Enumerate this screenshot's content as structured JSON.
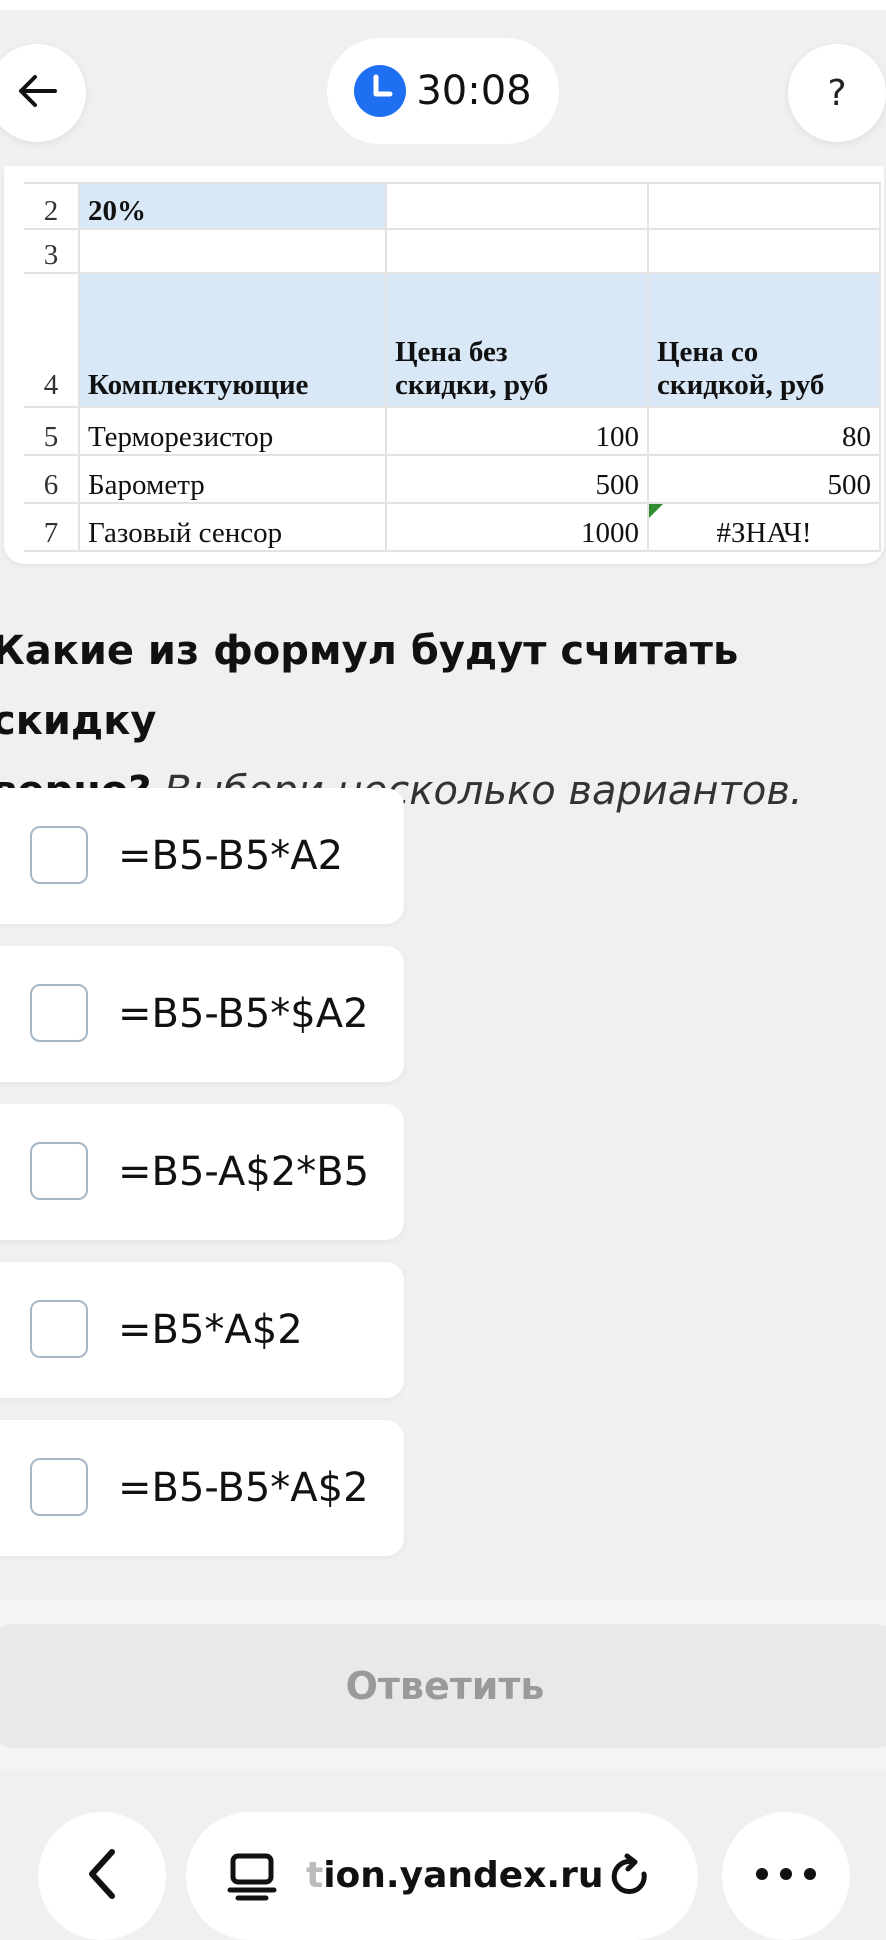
{
  "topbar": {
    "timer": "30:08",
    "help_label": "?"
  },
  "sheet": {
    "rows": [
      {
        "num": "2",
        "a": "20%",
        "b": "",
        "c": ""
      },
      {
        "num": "3",
        "a": "",
        "b": "",
        "c": ""
      },
      {
        "num": "4",
        "a": "Комплектующие",
        "b": "Цена без скидки, руб",
        "c": "Цена со скидкой, руб"
      },
      {
        "num": "5",
        "a": "Терморезистор",
        "b": "100",
        "c": "80"
      },
      {
        "num": "6",
        "a": "Барометр",
        "b": "500",
        "c": "500"
      },
      {
        "num": "7",
        "a": "Газовый сенсор",
        "b": "1000",
        "c": "#ЗНАЧ!"
      }
    ],
    "header_b_line1": "Цена без",
    "header_b_line2": "скидки, руб",
    "header_c_line1": "Цена со",
    "header_c_line2": "скидкой, руб"
  },
  "question": {
    "line1": "Какие из формул будут считать скидку",
    "line2_bold": "верно?",
    "hint": "Выбери несколько вариантов."
  },
  "options": [
    {
      "label": "=B5-B5*A2",
      "checked": false
    },
    {
      "label": "=B5-B5*$A2",
      "checked": false
    },
    {
      "label": "=B5-A$2*B5",
      "checked": false
    },
    {
      "label": "=B5*A$2",
      "checked": false
    },
    {
      "label": "=B5-B5*A$2",
      "checked": false
    }
  ],
  "answer_button": {
    "label": "Ответить"
  },
  "browser": {
    "url_prefix": "t",
    "url_rest": "ion.yandex.ru"
  },
  "colors": {
    "accent_blue": "#1f6ff2",
    "header_highlight": "#d9e8f6",
    "error_marker": "#2e8b2e",
    "disabled_text": "#9a9a9a"
  }
}
